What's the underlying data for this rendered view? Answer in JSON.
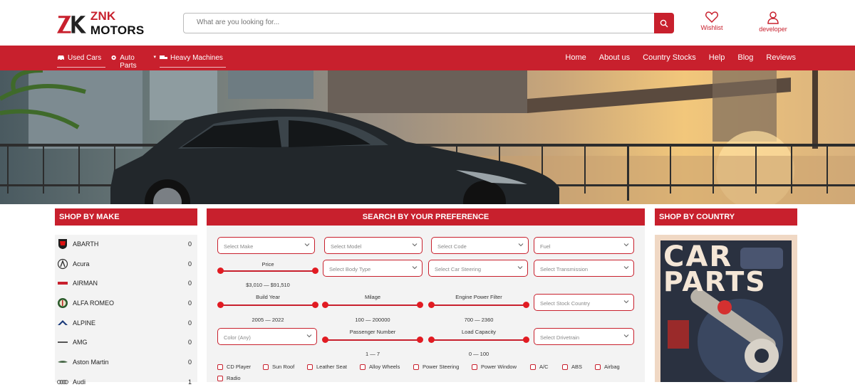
{
  "brand": {
    "name_prefix": "ZNK",
    "name_suffix": " MOTORS"
  },
  "search": {
    "placeholder": "What are you looking for..."
  },
  "header_actions": {
    "wishlist": "Wishlist",
    "user": "developer"
  },
  "nav": {
    "left": [
      "Used Cars",
      "Auto Parts",
      "Heavy Machines"
    ],
    "right": [
      "Home",
      "About us",
      "Country Stocks",
      "Help",
      "Blog",
      "Reviews"
    ]
  },
  "sections": {
    "make_title": "SHOP BY MAKE",
    "pref_title": "SEARCH BY YOUR PREFERENCE",
    "country_title": "SHOP BY COUNTRY"
  },
  "makes": [
    {
      "name": "ABARTH",
      "count": "0"
    },
    {
      "name": "Acura",
      "count": "0"
    },
    {
      "name": "AIRMAN",
      "count": "0"
    },
    {
      "name": "ALFA ROMEO",
      "count": "0"
    },
    {
      "name": "ALPINE",
      "count": "0"
    },
    {
      "name": "AMG",
      "count": "0"
    },
    {
      "name": "Aston Martin",
      "count": "0"
    },
    {
      "name": "Audi",
      "count": "1"
    }
  ],
  "pref": {
    "make": "Select Make",
    "model": "Select Model",
    "code": "Select Code",
    "fuel": "Fuel",
    "body": "Select Body Type",
    "steering": "Select Car Steering",
    "transmission": "Select Transmission",
    "stock_country": "Select Stock Country",
    "color": "Color (Any)",
    "drivetrain": "Select Drivetrain",
    "price_label": "Price",
    "price_range": "$3,010 — $91,510",
    "year_label": "Build Year",
    "year_range": "2005 — 2022",
    "mileage_label": "Milage",
    "mileage_range": "100 — 200000",
    "engine_label": "Engine Power Filter",
    "engine_range": "700 — 2360",
    "passenger_label": "Passenger Number",
    "passenger_range": "1 — 7",
    "load_label": "Load Capacity",
    "load_range": "0 — 100",
    "features": [
      "CD Player",
      "Sun Roof",
      "Leather Seat",
      "Alloy Wheels",
      "Power Steering",
      "Power Window",
      "A/C",
      "ABS",
      "Airbag",
      "Radio"
    ]
  },
  "country_banner": {
    "line1": "CAR",
    "line2": "PARTS"
  },
  "colors": {
    "accent": "#c8202d"
  }
}
